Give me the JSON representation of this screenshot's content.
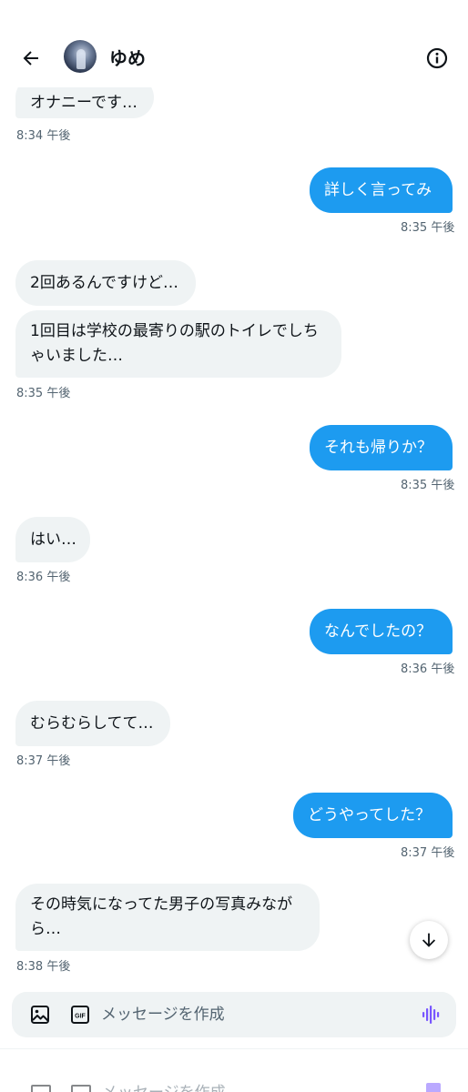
{
  "header": {
    "name": "ゆめ",
    "back_icon": "arrow-left-icon",
    "info_icon": "info-icon"
  },
  "messages": [
    {
      "from": "them",
      "text": "オナニーです…"
    },
    {
      "from": "them_time",
      "time": "8:34 午後"
    },
    {
      "from": "me",
      "text": "詳しく言ってみ",
      "time": "8:35 午後"
    },
    {
      "from": "them",
      "text": "2回あるんですけど…"
    },
    {
      "from": "them",
      "text": "1回目は学校の最寄りの駅のトイレでしちゃいました…",
      "time": "8:35 午後"
    },
    {
      "from": "me",
      "text": "それも帰りか？",
      "time": "8:35 午後"
    },
    {
      "from": "them",
      "text": "はい…",
      "time": "8:36 午後"
    },
    {
      "from": "me",
      "text": "なんでしたの？",
      "time": "8:36 午後"
    },
    {
      "from": "them",
      "text": "むらむらしてて…",
      "time": "8:37 午後"
    },
    {
      "from": "me",
      "text": "どうやってした？",
      "time": "8:37 午後"
    },
    {
      "from": "them",
      "text": "その時気になってた男子の写真みながら…",
      "time": "8:38 午後"
    }
  ],
  "composer": {
    "placeholder": "メッセージを作成",
    "image_icon": "image-icon",
    "gif_icon": "gif-icon",
    "voice_icon": "voice-wave-icon",
    "gif_label": "GIF"
  },
  "colors": {
    "sent_bubble": "#1d9bf0",
    "received_bubble": "#eff3f4",
    "timestamp": "#536471",
    "voice_accent": "#7856ff"
  }
}
